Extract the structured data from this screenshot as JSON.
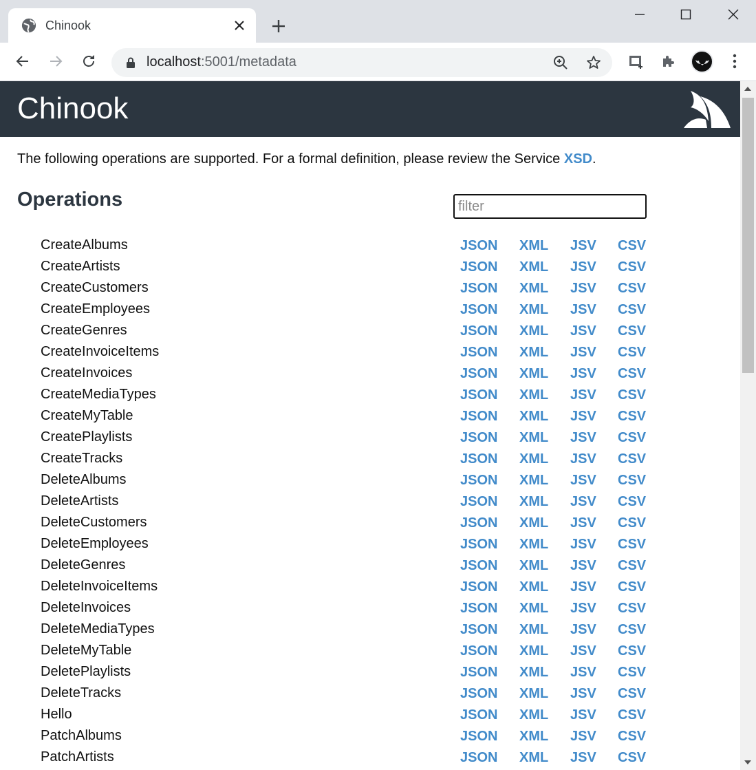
{
  "browser": {
    "tab_title": "Chinook",
    "url_host": "localhost",
    "url_rest": ":5001/metadata"
  },
  "page": {
    "site_title": "Chinook",
    "intro_text": "The following operations are supported. For a formal definition, please review the Service ",
    "intro_link": "XSD",
    "intro_end": ".",
    "operations_heading": "Operations",
    "filter_placeholder": "filter",
    "formats": [
      "JSON",
      "XML",
      "JSV",
      "CSV"
    ],
    "operations": [
      "CreateAlbums",
      "CreateArtists",
      "CreateCustomers",
      "CreateEmployees",
      "CreateGenres",
      "CreateInvoiceItems",
      "CreateInvoices",
      "CreateMediaTypes",
      "CreateMyTable",
      "CreatePlaylists",
      "CreateTracks",
      "DeleteAlbums",
      "DeleteArtists",
      "DeleteCustomers",
      "DeleteEmployees",
      "DeleteGenres",
      "DeleteInvoiceItems",
      "DeleteInvoices",
      "DeleteMediaTypes",
      "DeleteMyTable",
      "DeletePlaylists",
      "DeleteTracks",
      "Hello",
      "PatchAlbums",
      "PatchArtists"
    ]
  },
  "colors": {
    "header_bg": "#2c3640",
    "link": "#428bca",
    "tabstrip": "#dee1e6"
  },
  "icons": {
    "tab": "globe-icon",
    "close": "close-icon",
    "new_tab": "plus-icon",
    "back": "back-arrow-icon",
    "forward": "forward-arrow-icon",
    "reload": "reload-icon",
    "lock": "lock-icon",
    "zoom": "zoom-icon",
    "bookmark": "star-icon",
    "extensions": "puzzle-icon"
  }
}
